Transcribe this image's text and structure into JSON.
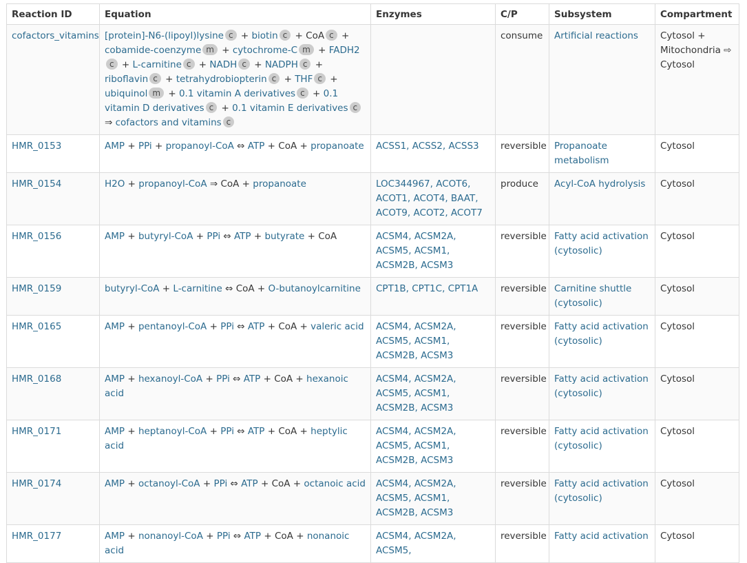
{
  "columns": [
    "Reaction ID",
    "Equation",
    "Enzymes",
    "C/P",
    "Subsystem",
    "Compartment"
  ],
  "rows": [
    {
      "id": "cofactors_vitamins",
      "equation": [
        {
          "t": "m",
          "v": "[protein]-N6-(lipoyl)lysine"
        },
        {
          "t": "c",
          "v": "c"
        },
        {
          "t": "s",
          "v": " + "
        },
        {
          "t": "m",
          "v": "biotin"
        },
        {
          "t": "c",
          "v": "c"
        },
        {
          "t": "s",
          "v": " + "
        },
        {
          "t": "p",
          "v": "CoA"
        },
        {
          "t": "c",
          "v": "c"
        },
        {
          "t": "s",
          "v": " + "
        },
        {
          "t": "m",
          "v": "cobamide-coenzyme"
        },
        {
          "t": "c",
          "v": "m"
        },
        {
          "t": "s",
          "v": " + "
        },
        {
          "t": "m",
          "v": "cytochrome-C"
        },
        {
          "t": "c",
          "v": "m"
        },
        {
          "t": "s",
          "v": " + "
        },
        {
          "t": "m",
          "v": "FADH2"
        },
        {
          "t": "c",
          "v": "c"
        },
        {
          "t": "s",
          "v": " + "
        },
        {
          "t": "m",
          "v": "L-carnitine"
        },
        {
          "t": "c",
          "v": "c"
        },
        {
          "t": "s",
          "v": " + "
        },
        {
          "t": "m",
          "v": "NADH"
        },
        {
          "t": "c",
          "v": "c"
        },
        {
          "t": "s",
          "v": " + "
        },
        {
          "t": "m",
          "v": "NADPH"
        },
        {
          "t": "c",
          "v": "c"
        },
        {
          "t": "s",
          "v": " + "
        },
        {
          "t": "m",
          "v": "riboflavin"
        },
        {
          "t": "c",
          "v": "c"
        },
        {
          "t": "s",
          "v": " + "
        },
        {
          "t": "m",
          "v": "tetrahydrobiopterin"
        },
        {
          "t": "c",
          "v": "c"
        },
        {
          "t": "s",
          "v": " + "
        },
        {
          "t": "m",
          "v": "THF"
        },
        {
          "t": "c",
          "v": "c"
        },
        {
          "t": "s",
          "v": " + "
        },
        {
          "t": "m",
          "v": "ubiquinol"
        },
        {
          "t": "c",
          "v": "m"
        },
        {
          "t": "s",
          "v": " + "
        },
        {
          "t": "m",
          "v": "0.1 vitamin A derivatives"
        },
        {
          "t": "c",
          "v": "c"
        },
        {
          "t": "s",
          "v": " + "
        },
        {
          "t": "m",
          "v": "0.1 vitamin D derivatives"
        },
        {
          "t": "c",
          "v": "c"
        },
        {
          "t": "s",
          "v": " + "
        },
        {
          "t": "m",
          "v": "0.1 vitamin E derivatives"
        },
        {
          "t": "c",
          "v": "c"
        },
        {
          "t": "s",
          "v": " ⇒ "
        },
        {
          "t": "m",
          "v": "cofactors and vitamins"
        },
        {
          "t": "c",
          "v": "c"
        }
      ],
      "enzymes": "",
      "cp": "consume",
      "subsystem": "Artificial reactions",
      "compartment": "Cytosol + Mitochondria ⇨ Cytosol"
    },
    {
      "id": "HMR_0153",
      "equation": [
        {
          "t": "m",
          "v": "AMP"
        },
        {
          "t": "s",
          "v": " + "
        },
        {
          "t": "m",
          "v": "PPi"
        },
        {
          "t": "s",
          "v": " + "
        },
        {
          "t": "m",
          "v": "propanoyl-CoA"
        },
        {
          "t": "s",
          "v": " ⇔ "
        },
        {
          "t": "m",
          "v": "ATP"
        },
        {
          "t": "s",
          "v": " + "
        },
        {
          "t": "p",
          "v": "CoA"
        },
        {
          "t": "s",
          "v": " + "
        },
        {
          "t": "m",
          "v": "propanoate"
        }
      ],
      "enzymes": "ACSS1, ACSS2, ACSS3",
      "cp": "reversible",
      "subsystem": "Propanoate metabolism",
      "compartment": "Cytosol"
    },
    {
      "id": "HMR_0154",
      "equation": [
        {
          "t": "m",
          "v": "H2O"
        },
        {
          "t": "s",
          "v": " + "
        },
        {
          "t": "m",
          "v": "propanoyl-CoA"
        },
        {
          "t": "s",
          "v": " ⇒ "
        },
        {
          "t": "p",
          "v": "CoA"
        },
        {
          "t": "s",
          "v": " + "
        },
        {
          "t": "m",
          "v": "propanoate"
        }
      ],
      "enzymes": "LOC344967, ACOT6, ACOT1, ACOT4, BAAT, ACOT9, ACOT2, ACOT7",
      "cp": "produce",
      "subsystem": "Acyl-CoA hydrolysis",
      "compartment": "Cytosol"
    },
    {
      "id": "HMR_0156",
      "equation": [
        {
          "t": "m",
          "v": "AMP"
        },
        {
          "t": "s",
          "v": " + "
        },
        {
          "t": "m",
          "v": "butyryl-CoA"
        },
        {
          "t": "s",
          "v": " + "
        },
        {
          "t": "m",
          "v": "PPi"
        },
        {
          "t": "s",
          "v": " ⇔ "
        },
        {
          "t": "m",
          "v": "ATP"
        },
        {
          "t": "s",
          "v": " + "
        },
        {
          "t": "m",
          "v": "butyrate"
        },
        {
          "t": "s",
          "v": " + "
        },
        {
          "t": "p",
          "v": "CoA"
        }
      ],
      "enzymes": "ACSM4, ACSM2A, ACSM5, ACSM1, ACSM2B, ACSM3",
      "cp": "reversible",
      "subsystem": "Fatty acid activation (cytosolic)",
      "compartment": "Cytosol"
    },
    {
      "id": "HMR_0159",
      "equation": [
        {
          "t": "m",
          "v": "butyryl-CoA"
        },
        {
          "t": "s",
          "v": " + "
        },
        {
          "t": "m",
          "v": "L-carnitine"
        },
        {
          "t": "s",
          "v": " ⇔ "
        },
        {
          "t": "p",
          "v": "CoA"
        },
        {
          "t": "s",
          "v": " + "
        },
        {
          "t": "m",
          "v": "O-butanoylcarnitine"
        }
      ],
      "enzymes": "CPT1B, CPT1C, CPT1A",
      "cp": "reversible",
      "subsystem": "Carnitine shuttle (cytosolic)",
      "compartment": "Cytosol"
    },
    {
      "id": "HMR_0165",
      "equation": [
        {
          "t": "m",
          "v": "AMP"
        },
        {
          "t": "s",
          "v": " + "
        },
        {
          "t": "m",
          "v": "pentanoyl-CoA"
        },
        {
          "t": "s",
          "v": " + "
        },
        {
          "t": "m",
          "v": "PPi"
        },
        {
          "t": "s",
          "v": " ⇔ "
        },
        {
          "t": "m",
          "v": "ATP"
        },
        {
          "t": "s",
          "v": " + "
        },
        {
          "t": "p",
          "v": "CoA"
        },
        {
          "t": "s",
          "v": " + "
        },
        {
          "t": "m",
          "v": "valeric acid"
        }
      ],
      "enzymes": "ACSM4, ACSM2A, ACSM5, ACSM1, ACSM2B, ACSM3",
      "cp": "reversible",
      "subsystem": "Fatty acid activation (cytosolic)",
      "compartment": "Cytosol"
    },
    {
      "id": "HMR_0168",
      "equation": [
        {
          "t": "m",
          "v": "AMP"
        },
        {
          "t": "s",
          "v": " + "
        },
        {
          "t": "m",
          "v": "hexanoyl-CoA"
        },
        {
          "t": "s",
          "v": " + "
        },
        {
          "t": "m",
          "v": "PPi"
        },
        {
          "t": "s",
          "v": " ⇔ "
        },
        {
          "t": "m",
          "v": "ATP"
        },
        {
          "t": "s",
          "v": " + "
        },
        {
          "t": "p",
          "v": "CoA"
        },
        {
          "t": "s",
          "v": " + "
        },
        {
          "t": "m",
          "v": "hexanoic acid"
        }
      ],
      "enzymes": "ACSM4, ACSM2A, ACSM5, ACSM1, ACSM2B, ACSM3",
      "cp": "reversible",
      "subsystem": "Fatty acid activation (cytosolic)",
      "compartment": "Cytosol"
    },
    {
      "id": "HMR_0171",
      "equation": [
        {
          "t": "m",
          "v": "AMP"
        },
        {
          "t": "s",
          "v": " + "
        },
        {
          "t": "m",
          "v": "heptanoyl-CoA"
        },
        {
          "t": "s",
          "v": " + "
        },
        {
          "t": "m",
          "v": "PPi"
        },
        {
          "t": "s",
          "v": " ⇔ "
        },
        {
          "t": "m",
          "v": "ATP"
        },
        {
          "t": "s",
          "v": " + "
        },
        {
          "t": "p",
          "v": "CoA"
        },
        {
          "t": "s",
          "v": " + "
        },
        {
          "t": "m",
          "v": "heptylic acid"
        }
      ],
      "enzymes": "ACSM4, ACSM2A, ACSM5, ACSM1, ACSM2B, ACSM3",
      "cp": "reversible",
      "subsystem": "Fatty acid activation (cytosolic)",
      "compartment": "Cytosol"
    },
    {
      "id": "HMR_0174",
      "equation": [
        {
          "t": "m",
          "v": "AMP"
        },
        {
          "t": "s",
          "v": " + "
        },
        {
          "t": "m",
          "v": "octanoyl-CoA"
        },
        {
          "t": "s",
          "v": " + "
        },
        {
          "t": "m",
          "v": "PPi"
        },
        {
          "t": "s",
          "v": " ⇔ "
        },
        {
          "t": "m",
          "v": "ATP"
        },
        {
          "t": "s",
          "v": " + "
        },
        {
          "t": "p",
          "v": "CoA"
        },
        {
          "t": "s",
          "v": " + "
        },
        {
          "t": "m",
          "v": "octanoic acid"
        }
      ],
      "enzymes": "ACSM4, ACSM2A, ACSM5, ACSM1, ACSM2B, ACSM3",
      "cp": "reversible",
      "subsystem": "Fatty acid activation (cytosolic)",
      "compartment": "Cytosol"
    },
    {
      "id": "HMR_0177",
      "equation": [
        {
          "t": "m",
          "v": "AMP"
        },
        {
          "t": "s",
          "v": " + "
        },
        {
          "t": "m",
          "v": "nonanoyl-CoA"
        },
        {
          "t": "s",
          "v": " + "
        },
        {
          "t": "m",
          "v": "PPi"
        },
        {
          "t": "s",
          "v": " ⇔ "
        },
        {
          "t": "m",
          "v": "ATP"
        },
        {
          "t": "s",
          "v": " + "
        },
        {
          "t": "p",
          "v": "CoA"
        },
        {
          "t": "s",
          "v": " + "
        },
        {
          "t": "m",
          "v": "nonanoic acid"
        }
      ],
      "enzymes": "ACSM4, ACSM2A, ACSM5,",
      "cp": "reversible",
      "subsystem": "Fatty acid activation",
      "compartment": "Cytosol"
    }
  ]
}
